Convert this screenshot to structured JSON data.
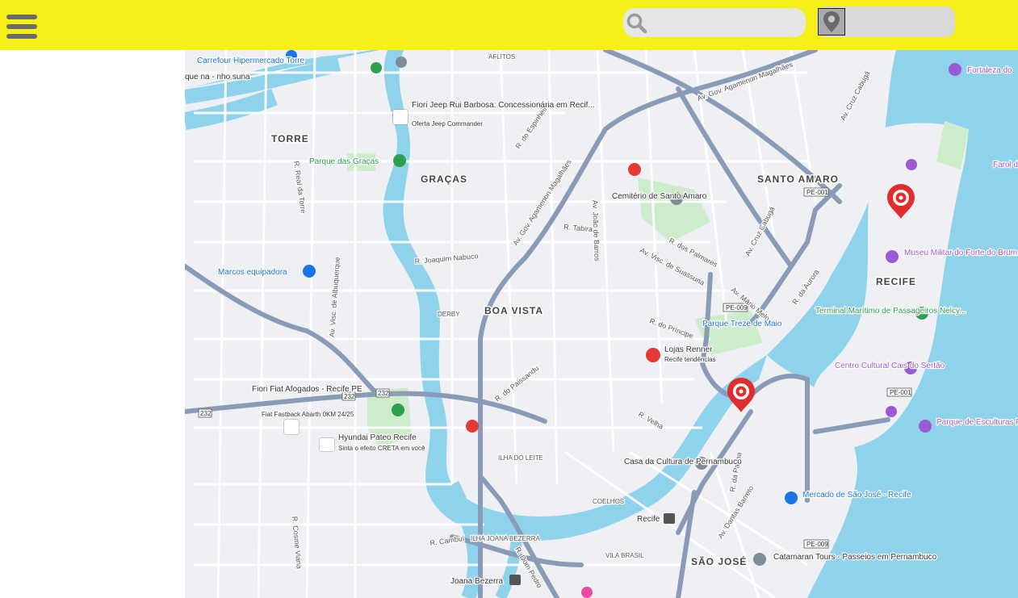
{
  "header": {
    "menu_icon": "hamburger-menu-icon",
    "search": {
      "icon": "search-icon",
      "placeholder": "",
      "value": ""
    },
    "location_button": {
      "icon": "map-pin-icon",
      "label": ""
    },
    "colors": {
      "bar": "#f6ef18",
      "control": "#e6e6e6"
    }
  },
  "map": {
    "colors": {
      "water": "#8fd2ec",
      "park": "#cdeccc",
      "road_major": "#8a9bb8",
      "marker": "#e02d2d"
    },
    "neighborhoods": [
      "TORRE",
      "GRAÇAS",
      "SANTO AMARO",
      "BOA VISTA",
      "RECIFE",
      "DERBY",
      "ILHA DO LEITE",
      "COELHOS",
      "VILA BRASIL",
      "SÃO JOSÉ",
      "AFLITOS",
      "ILHA JOANA BEZERRA"
    ],
    "streets": [
      "Av. Gov. Agamenon Magalhães",
      "R. Joaquim Nabuco",
      "Av. Cruz Cabugá",
      "R. do Príncipe",
      "Av. Visc. de Suassuna",
      "R. dos Palmares",
      "R. Tabira",
      "R. Real da Torre",
      "Av. Visc. de Albuquerque",
      "R. Cosme Viana",
      "R. do Paissandu",
      "R. Velha",
      "Av. Dantas Barreto",
      "R. da Palma",
      "Av. Mário Melo",
      "R. da Aurora",
      "R. do Espinheiro",
      "Av. João de Barros",
      "R. Cambuí",
      "R. Dom Pedro"
    ],
    "pois": [
      {
        "name": "Carrefour Hipermercado Torre"
      },
      {
        "name": "Fiori Jeep Rui Barbosa: Concessionária em Recif...",
        "sub": "Oferta Jeep Commander"
      },
      {
        "name": "Parque das Graças"
      },
      {
        "name": "Cemitério de Santo Amaro"
      },
      {
        "name": "Marcos equipadora"
      },
      {
        "name": "Museu Militar do Forte do Brum"
      },
      {
        "name": "Terminal Marítimo de Passageiros Nelcy..."
      },
      {
        "name": "Parque Treze de Maio"
      },
      {
        "name": "Lojas Renner",
        "sub": "Recife tendências"
      },
      {
        "name": "Centro Cultural Cais do Sertão"
      },
      {
        "name": "Fiori Fiat Afogados - Recife PE",
        "sub": "Fiat Fastback Abarth 0KM 24/25"
      },
      {
        "name": "Hyundai Pateo Recife",
        "sub": "Sinta o efeito CRETA em você"
      },
      {
        "name": "Casa da Cultura de Pernambuco"
      },
      {
        "name": "Mercado de São José - Recife"
      },
      {
        "name": "Parque de Esculturas Francisco Brennand"
      },
      {
        "name": "Catamaran Tours - Passeios em Pernambuco"
      },
      {
        "name": "Recife"
      },
      {
        "name": "Joana Bezerra"
      },
      {
        "name": "Fortaleza do"
      },
      {
        "name": "Farol d"
      },
      {
        "name": "que na - nho suna"
      }
    ],
    "route_shields": [
      "PE-001",
      "PE-009",
      "232"
    ],
    "markers": [
      {
        "name": "marker-1",
        "near": "Forte do Brum"
      },
      {
        "name": "marker-2",
        "near": "R. da Aurora"
      }
    ]
  }
}
